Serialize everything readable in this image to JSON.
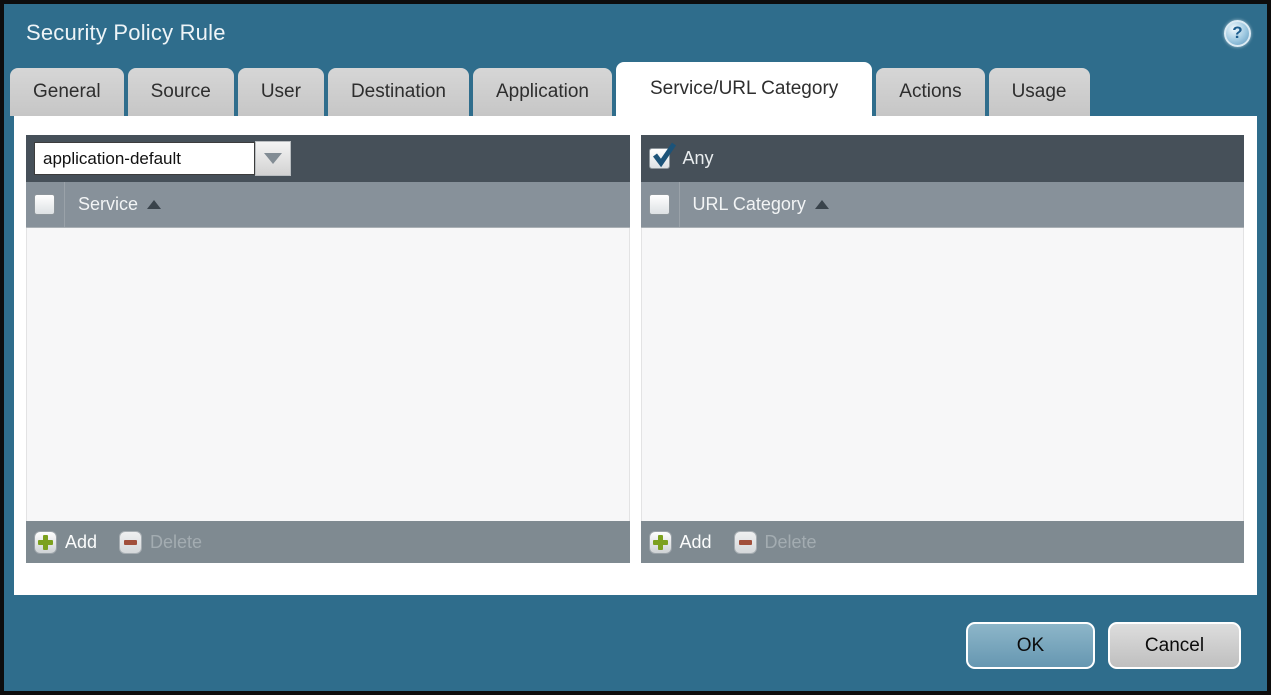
{
  "dialog": {
    "title": "Security Policy Rule",
    "help_icon_glyph": "?"
  },
  "tabs": [
    {
      "label": "General",
      "active": false
    },
    {
      "label": "Source",
      "active": false
    },
    {
      "label": "User",
      "active": false
    },
    {
      "label": "Destination",
      "active": false
    },
    {
      "label": "Application",
      "active": false
    },
    {
      "label": "Service/URL Category",
      "active": true
    },
    {
      "label": "Actions",
      "active": false
    },
    {
      "label": "Usage",
      "active": false
    }
  ],
  "service_panel": {
    "dropdown_value": "application-default",
    "column_header": "Service",
    "rows": [],
    "select_all_checked": false,
    "add_label": "Add",
    "delete_label": "Delete",
    "delete_enabled": false
  },
  "url_category_panel": {
    "any_label": "Any",
    "any_checked": true,
    "column_header": "URL Category",
    "rows": [],
    "select_all_checked": false,
    "add_label": "Add",
    "delete_label": "Delete",
    "delete_enabled": false
  },
  "footer_buttons": {
    "ok_label": "OK",
    "cancel_label": "Cancel"
  },
  "colors": {
    "dialog_background": "#2f6d8c",
    "dialog_border": "#0d0d0d",
    "titlebar_text": "#eef4f7",
    "active_tab": "#ffffff",
    "inactive_tab": "#c9c9c9",
    "panel_header_bar": "#465059",
    "column_header_bar": "#87919a",
    "panel_footer_bar": "#7f8a91",
    "panel_body": "#f7f7f8",
    "ok_button": "#6fa2ba",
    "cancel_button": "#cccccc",
    "add_icon_green": "#7ca11e",
    "delete_icon_red": "#a14f3b",
    "checkbox_check_blue": "#1c5379"
  }
}
